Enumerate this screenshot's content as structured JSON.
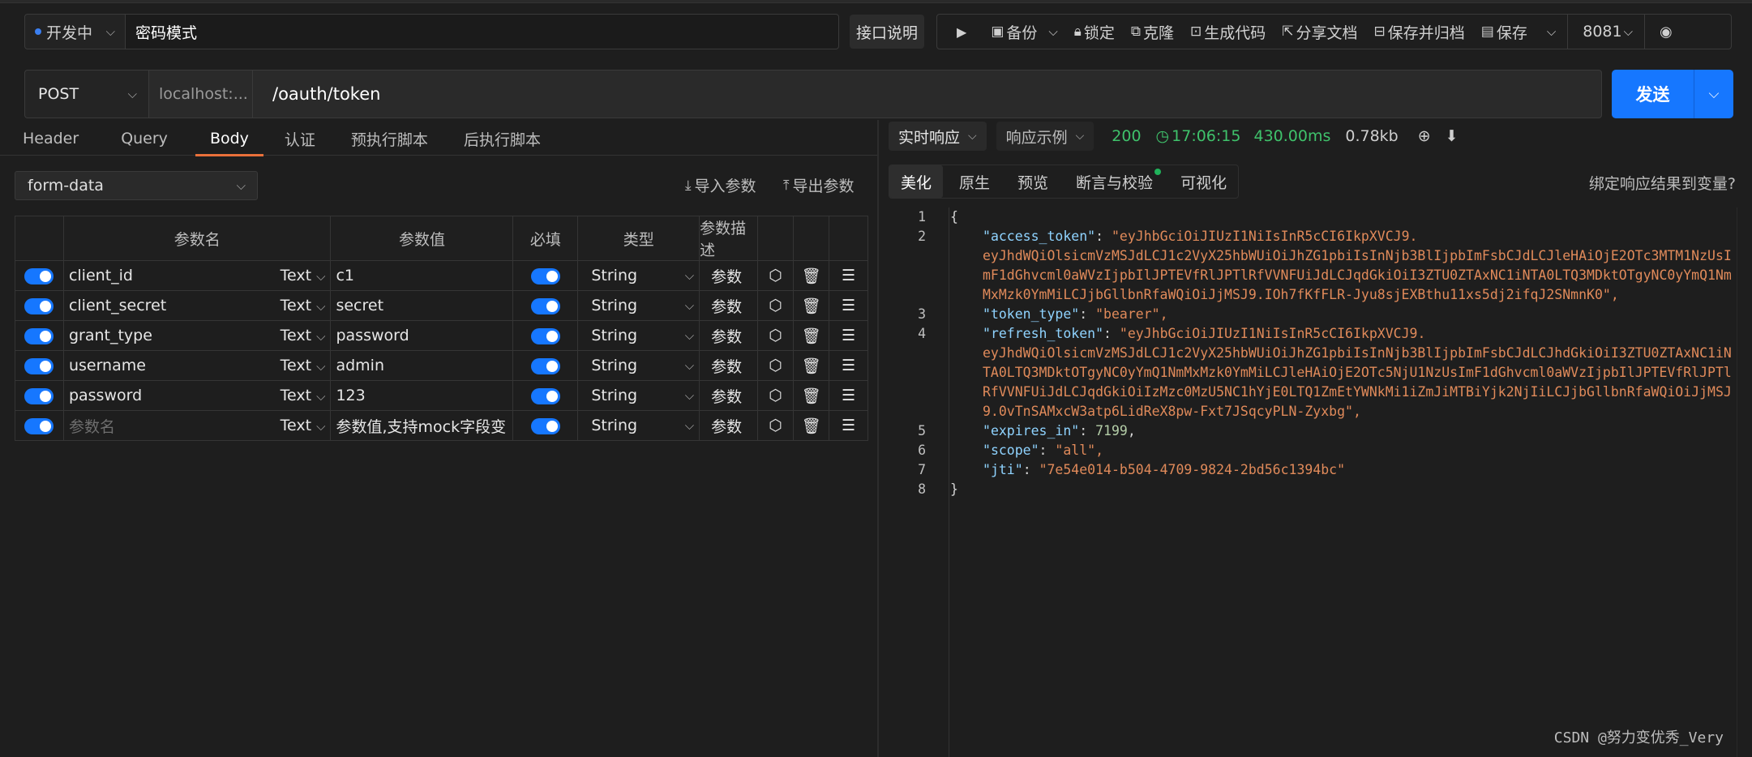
{
  "top": {
    "env_label": "开发中",
    "title": "密码模式",
    "doc_button": "接口说明",
    "toolbar": {
      "backup": "备份",
      "lock": "锁定",
      "clone": "克隆",
      "gen_code": "生成代码",
      "share_doc": "分享文档",
      "save_archive": "保存并归档",
      "save": "保存",
      "port": "8081"
    }
  },
  "request": {
    "method": "POST",
    "host": "localhost:...",
    "path": "/oauth/token",
    "send": "发送"
  },
  "tabs": [
    "Header",
    "Query",
    "Body",
    "认证",
    "预执行脚本",
    "后执行脚本"
  ],
  "body": {
    "type": "form-data",
    "import": "导入参数",
    "export": "导出参数",
    "headers": [
      "参数名",
      "参数值",
      "必填",
      "类型",
      "参数描述"
    ],
    "rows": [
      {
        "name": "client_id",
        "kind": "Text",
        "value": "c1",
        "type": "String",
        "desc": "参数"
      },
      {
        "name": "client_secret",
        "kind": "Text",
        "value": "secret",
        "type": "String",
        "desc": "参数"
      },
      {
        "name": "grant_type",
        "kind": "Text",
        "value": "password",
        "type": "String",
        "desc": "参数"
      },
      {
        "name": "username",
        "kind": "Text",
        "value": "admin",
        "type": "String",
        "desc": "参数"
      },
      {
        "name": "password",
        "kind": "Text",
        "value": "123",
        "type": "String",
        "desc": "参数"
      },
      {
        "name": "参数名",
        "kind": "Text",
        "value": "参数值,支持mock字段变",
        "type": "String",
        "desc": "参数"
      }
    ]
  },
  "response": {
    "realtime": "实时响应",
    "example": "响应示例",
    "status": "200",
    "time": "17:06:15",
    "duration": "430.00ms",
    "size": "0.78kb",
    "tabs": [
      "美化",
      "原生",
      "预览",
      "断言与校验",
      "可视化"
    ],
    "bind": "绑定响应结果到变量?",
    "lines": [
      {
        "num": "1",
        "text": "{"
      },
      {
        "num": "2",
        "key": "access_token",
        "val": "eyJhbGciOiJIUzI1NiIsInR5cCI6IkpXVCJ9.",
        "cont": [
          "eyJhdWQiOlsicmVzMSJdLCJ1c2VyX25hbWUiOiJhZG1pbiIsInNjb3BlIjpbImFsbCJdLCJleHAiOjE2OTc3MTM1NzUsI",
          "mF1dGhvcml0aWVzIjpbIlJPTEVfRlJPTlRfVVNFUiJdLCJqdGkiOiI3ZTU0ZTAxNC1iNTA0LTQ3MDktOTgyNC0yYmQ1Nm",
          "MxMzk0YmMiLCJjbGllbnRfaWQiOiJjMSJ9.IOh7fKfFLR-Jyu8sjEXBthu11xs5dj2ifqJ2SNmnK0\","
        ]
      },
      {
        "num": "3",
        "key": "token_type",
        "val": "bearer\","
      },
      {
        "num": "4",
        "key": "refresh_token",
        "val": "eyJhbGciOiJIUzI1NiIsInR5cCI6IkpXVCJ9.",
        "cont": [
          "eyJhdWQiOlsicmVzMSJdLCJ1c2VyX25hbWUiOiJhZG1pbiIsInNjb3BlIjpbImFsbCJdLCJhdGkiOiI3ZTU0ZTAxNC1iN",
          "TA0LTQ3MDktOTgyNC0yYmQ1NmMxMzk0YmMiLCJleHAiOjE2OTc5NjU1NzUsImF1dGhvcml0aWVzIjpbIlJPTEVfRlJPTl",
          "RfVVNFUiJdLCJqdGkiOiIzMzc0MzU5NC1hYjE0LTQ1ZmEtYWNkMi1iZmJiMTBiYjk2NjIiLCJjbGllbnRfaWQiOiJjMSJ",
          "9.0vTnSAMxcW3atp6LidReX8pw-Fxt7JSqcyPLN-Zyxbg\","
        ]
      },
      {
        "num": "5",
        "key": "expires_in",
        "num_val": "7199"
      },
      {
        "num": "6",
        "key": "scope",
        "val": "all\","
      },
      {
        "num": "7",
        "key": "jti",
        "val": "7e54e014-b504-4709-9824-2bd56c1394bc\""
      },
      {
        "num": "8",
        "text": "}"
      }
    ]
  },
  "watermark": "CSDN @努力变优秀_Very"
}
